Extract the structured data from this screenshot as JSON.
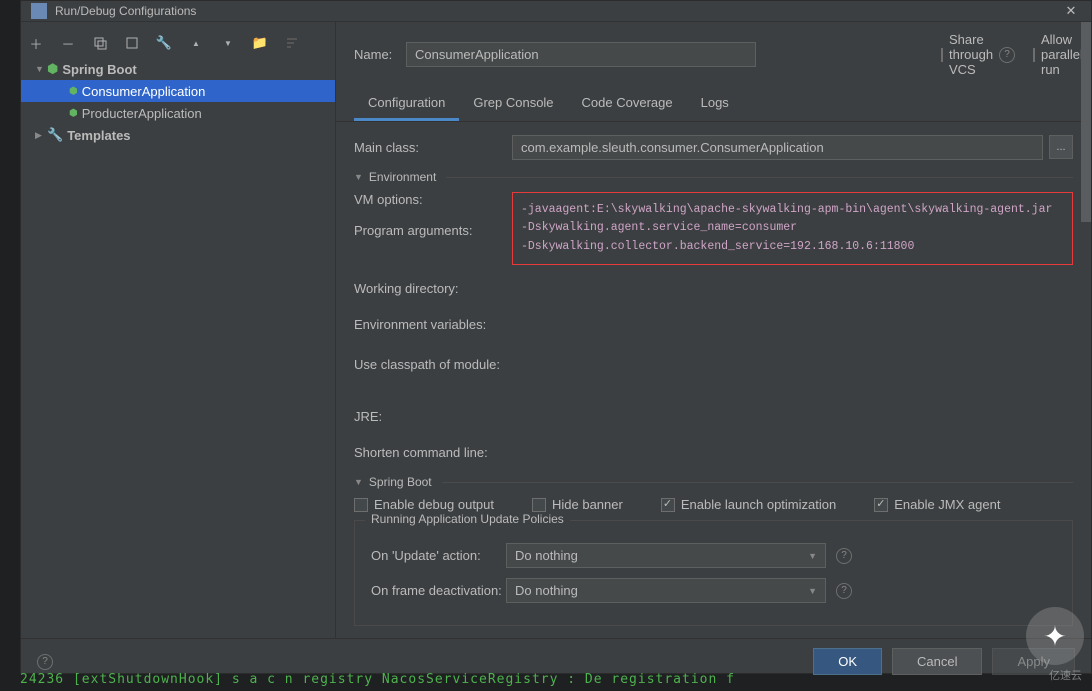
{
  "dialog": {
    "title": "Run/Debug Configurations"
  },
  "toolbar": {
    "add": "+",
    "remove": "−",
    "copy": "copy-icon",
    "save": "save-icon",
    "wrench": "wrench-icon",
    "up": "▲",
    "down": "▼",
    "folder": "folder-icon",
    "sort": "sort-icon"
  },
  "tree": {
    "root": "Spring Boot",
    "items": [
      "ConsumerApplication",
      "ProducterApplication"
    ],
    "selected": "ConsumerApplication",
    "templates": "Templates"
  },
  "header": {
    "name_label": "Name:",
    "name_value": "ConsumerApplication",
    "share_label": "Share through VCS",
    "parallel_label": "Allow parallel run"
  },
  "tabs": [
    "Configuration",
    "Grep Console",
    "Code Coverage",
    "Logs"
  ],
  "active_tab": "Configuration",
  "form": {
    "main_class_label": "Main class:",
    "main_class_value": "com.example.sleuth.consumer.ConsumerApplication",
    "env_section": "Environment",
    "vm_options_label": "VM options:",
    "vm_options_value": "-javaagent:E:\\skywalking\\apache-skywalking-apm-bin\\agent\\skywalking-agent.jar\n-Dskywalking.agent.service_name=consumer\n-Dskywalking.collector.backend_service=192.168.10.6:11800",
    "program_args_label": "Program arguments:",
    "working_dir_label": "Working directory:",
    "env_vars_label": "Environment variables:",
    "classpath_label": "Use classpath of module:",
    "jre_label": "JRE:",
    "shorten_label": "Shorten command line:",
    "spring_section": "Spring Boot",
    "chk_debug": "Enable debug output",
    "chk_hide": "Hide banner",
    "chk_launch": "Enable launch optimization",
    "chk_jmx": "Enable JMX agent",
    "chk_launch_checked": true,
    "chk_jmx_checked": true,
    "policies_legend": "Running Application Update Policies",
    "on_update_label": "On 'Update' action:",
    "on_update_value": "Do nothing",
    "on_frame_label": "On frame deactivation:",
    "on_frame_value": "Do nothing"
  },
  "footer": {
    "ok": "OK",
    "cancel": "Cancel",
    "apply": "Apply"
  },
  "watermark": "亿速云",
  "log": "24236       [extShutdownHook] s a c n registry NacosServiceRegistry     :  De registration f"
}
